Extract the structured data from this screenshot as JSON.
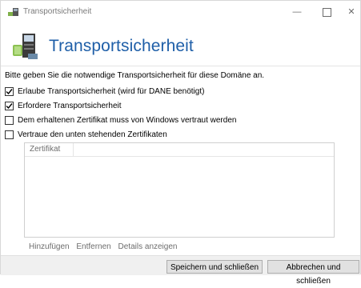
{
  "window": {
    "title": "Transportsicherheit",
    "controls": {
      "minimize": "—",
      "close": "✕"
    }
  },
  "header": {
    "title": "Transportsicherheit"
  },
  "instructions": "Bitte geben Sie die notwendige Transportsicherheit für diese Domäne an.",
  "options": [
    {
      "label": "Erlaube Transportsicherheit (wird für DANE benötigt)",
      "checked": true
    },
    {
      "label": "Erfordere Transportsicherheit",
      "checked": true
    },
    {
      "label": "Dem erhaltenen Zertifikat muss von Windows vertraut werden",
      "checked": false
    },
    {
      "label": "Vertraue den unten stehenden Zertifikaten",
      "checked": false
    }
  ],
  "cert_table": {
    "columns": [
      "Zertifikat"
    ]
  },
  "links": {
    "add": "Hinzufügen",
    "remove": "Entfernen",
    "details": "Details anzeigen"
  },
  "buttons": {
    "save": "Speichern und schließen",
    "cancel": "Abbrechen und schließen"
  },
  "colors": {
    "title_blue": "#1f5fa8",
    "link_gray": "#6d6d6d"
  }
}
